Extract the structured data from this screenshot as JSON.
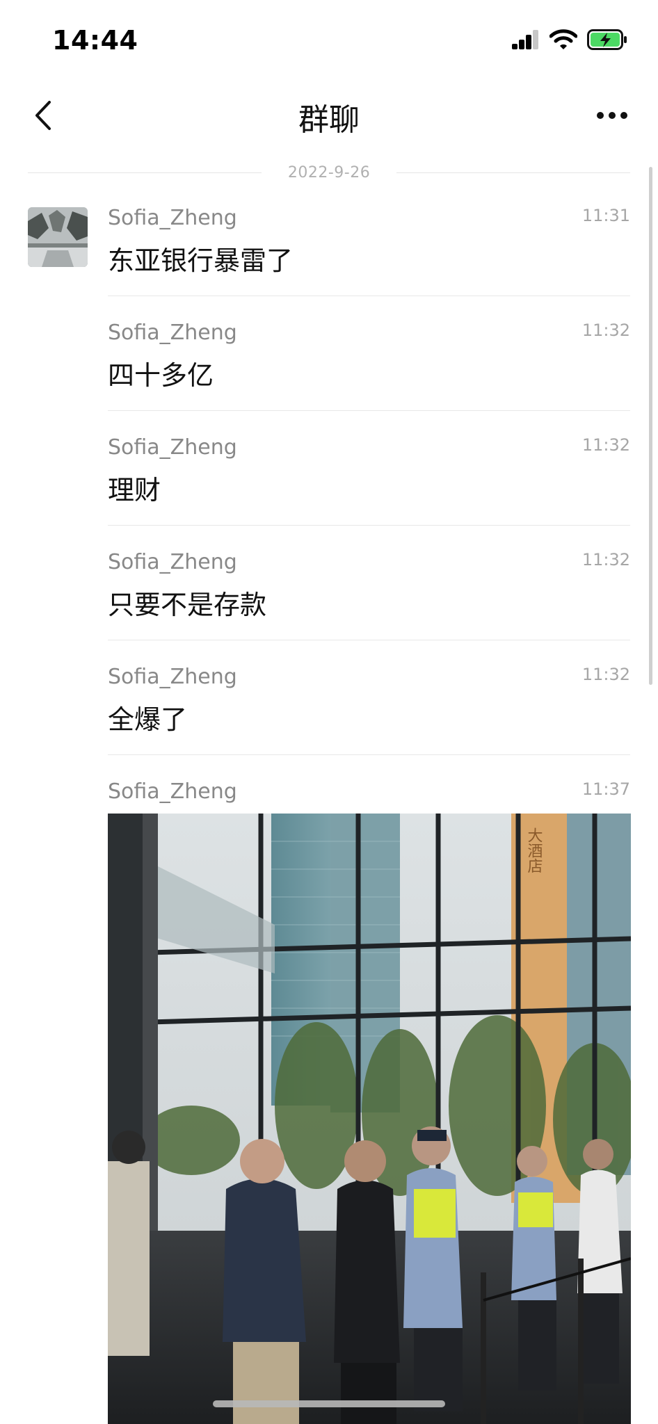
{
  "status_bar": {
    "time": "14:44"
  },
  "header": {
    "title": "群聊"
  },
  "date_separator": "2022-9-26",
  "messages": [
    {
      "sender": "Sofia_Zheng",
      "time": "11:31",
      "text": "东亚银行暴雷了"
    },
    {
      "sender": "Sofia_Zheng",
      "time": "11:32",
      "text": "四十多亿"
    },
    {
      "sender": "Sofia_Zheng",
      "time": "11:32",
      "text": "理财"
    },
    {
      "sender": "Sofia_Zheng",
      "time": "11:32",
      "text": "只要不是存款"
    },
    {
      "sender": "Sofia_Zheng",
      "time": "11:32",
      "text": "全爆了"
    },
    {
      "sender": "Sofia_Zheng",
      "time": "11:37",
      "text": ""
    }
  ],
  "photo_sign": "大酒店",
  "colors": {
    "background": "#ffffff",
    "battery": "#4cd964",
    "muted_text": "#888888"
  }
}
